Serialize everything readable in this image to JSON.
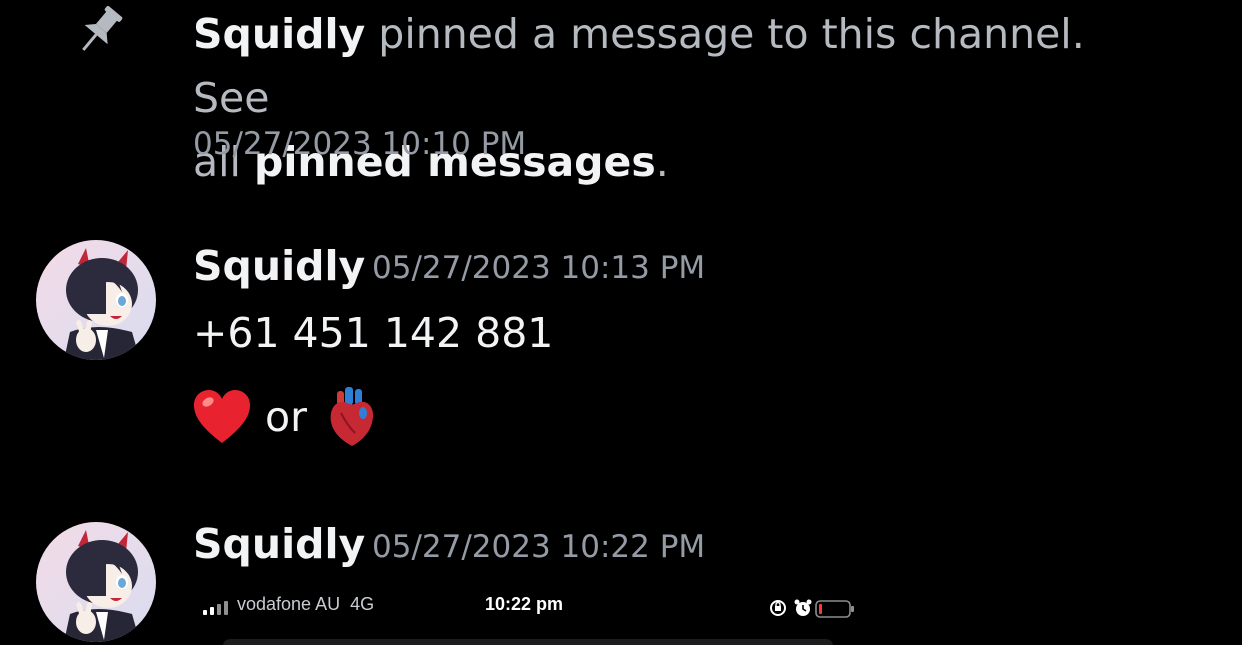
{
  "system_message": {
    "icon": "pin-icon",
    "author": "Squidly",
    "text_pinned": "pinned a message to this channel. See",
    "text_all": "all",
    "link_label": "pinned messages",
    "period": ".",
    "timestamp": "05/27/2023 10:10 PM"
  },
  "messages": [
    {
      "author": "Squidly",
      "timestamp": "05/27/2023 10:13 PM",
      "lines": [
        "+61 451 142 881"
      ],
      "emoji_line": {
        "first_emoji": "❤️",
        "connector": "or",
        "second_emoji": "🫀"
      }
    },
    {
      "author": "Squidly",
      "timestamp": "05/27/2023 10:22 PM",
      "attachment": {
        "carrier": "vodafone AU",
        "network": "4G",
        "time": "10:22 pm",
        "icons": [
          "signal-icon",
          "screen-lock-icon",
          "alarm-icon",
          "battery-low-icon"
        ]
      }
    }
  ],
  "colors": {
    "background": "#000000",
    "author": "#f2f3f5",
    "muted": "#949ba4",
    "system_text": "#b5bac1",
    "battery_low": "#ff3b30"
  }
}
